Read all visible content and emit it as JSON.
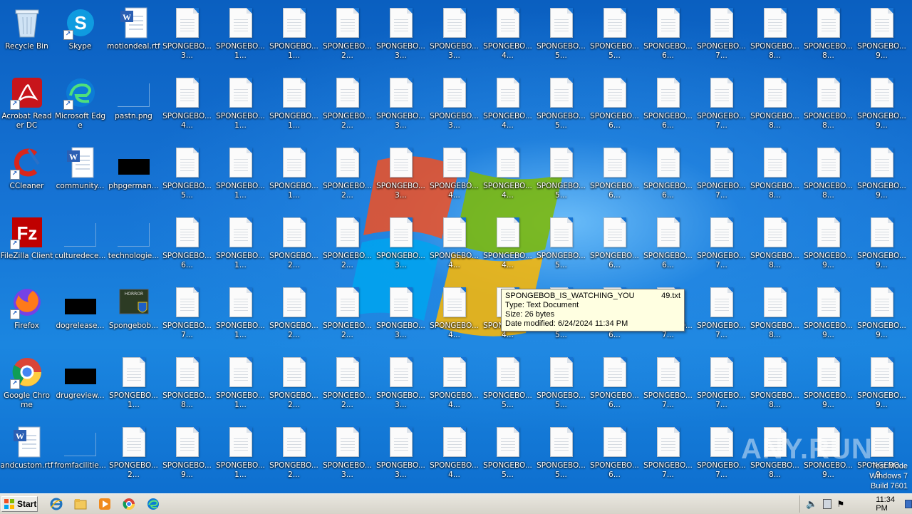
{
  "desktop": {
    "left_icons": [
      {
        "label": "Recycle Bin",
        "kind": "recycle-bin-icon"
      },
      {
        "label": "Skype",
        "kind": "skype-icon"
      },
      {
        "label": "motiondeal.rtf",
        "kind": "word-doc-icon"
      },
      {
        "label": "Acrobat Reader DC",
        "kind": "acrobat-icon"
      },
      {
        "label": "Microsoft Edge",
        "kind": "edge-icon"
      },
      {
        "label": "pastn.png",
        "kind": "image-file-icon"
      },
      {
        "label": "CCleaner",
        "kind": "ccleaner-icon"
      },
      {
        "label": "community...",
        "kind": "word-doc-icon"
      },
      {
        "label": "phpgerman...",
        "kind": "black-file-icon"
      },
      {
        "label": "FileZilla Client",
        "kind": "filezilla-icon"
      },
      {
        "label": "culturedece...",
        "kind": "image-file-icon"
      },
      {
        "label": "technologie...",
        "kind": "image-file-icon"
      },
      {
        "label": "Firefox",
        "kind": "firefox-icon"
      },
      {
        "label": "dogrelease...",
        "kind": "black-file-icon"
      },
      {
        "label": "Spongebob...",
        "kind": "installer-icon"
      },
      {
        "label": "Google Chrome",
        "kind": "chrome-icon"
      },
      {
        "label": "drugreview...",
        "kind": "black-file-icon"
      },
      {
        "label": "andcustom.rtf",
        "kind": "word-doc-icon"
      },
      {
        "label": "fromfacilitie...",
        "kind": "image-file-icon"
      }
    ],
    "sponge_rows": [
      [
        "3...",
        "1...",
        "1...",
        "2...",
        "3...",
        "3...",
        "4...",
        "5...",
        "5...",
        "6...",
        "7...",
        "8...",
        "8...",
        "9..."
      ],
      [
        "4...",
        "1...",
        "1...",
        "2...",
        "3...",
        "3...",
        "4...",
        "5...",
        "6...",
        "6...",
        "7...",
        "8...",
        "8...",
        "9..."
      ],
      [
        "5...",
        "1...",
        "1...",
        "2...",
        "3...",
        "4...",
        "4...",
        "5...",
        "6...",
        "6...",
        "7...",
        "8...",
        "8...",
        "9..."
      ],
      [
        "6...",
        "1...",
        "2...",
        "2...",
        "3...",
        "4...",
        "4...",
        "5...",
        "6...",
        "6...",
        "7...",
        "8...",
        "9...",
        "9..."
      ],
      [
        "7...",
        "1...",
        "2...",
        "2...",
        "3...",
        "4...",
        "4...",
        "5...",
        "6...",
        "7...",
        "7...",
        "8...",
        "9...",
        "9..."
      ],
      [
        "1...",
        "8...",
        "1...",
        "2...",
        "2...",
        "3...",
        "4...",
        "5...",
        "5...",
        "6...",
        "7...",
        "7...",
        "8...",
        "9...",
        "9..."
      ],
      [
        "2...",
        "9...",
        "1...",
        "2...",
        "3...",
        "3...",
        "4...",
        "5...",
        "5...",
        "6...",
        "7...",
        "7...",
        "8...",
        "9...",
        "9..."
      ]
    ],
    "sponge_prefix": "SPONGEBO..."
  },
  "tooltip": {
    "name": "SPONGEBOB_IS_WATCHING_YOU",
    "ext": "49.txt",
    "type": "Type: Text Document",
    "size": "Size: 26 bytes",
    "modified": "Date modified: 6/24/2024 11:34 PM"
  },
  "watermark": "ANY.RUN",
  "sysinfo": {
    "line1": "Test Mode",
    "line2": "Windows 7",
    "line3": "Build 7601"
  },
  "taskbar": {
    "start_label": "Start",
    "pinned": [
      "internet-explorer-icon",
      "file-explorer-icon",
      "media-player-icon",
      "chrome-icon",
      "edge-icon"
    ],
    "clock": "11:34 PM"
  },
  "colors": {
    "desktop_blue": "#1673d4",
    "tooltip_bg": "#ffffe1",
    "taskbar_bg": "#d6d3c9"
  }
}
